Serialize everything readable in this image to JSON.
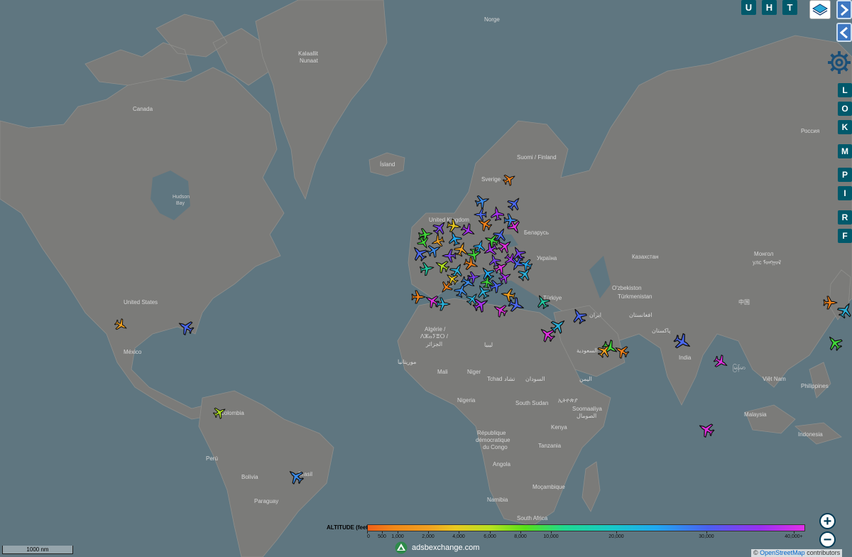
{
  "toolbar": {
    "btn_u": "U",
    "btn_h": "H",
    "btn_t": "T"
  },
  "side_buttons": [
    "L",
    "O",
    "K",
    "M",
    "P",
    "I",
    "R",
    "F"
  ],
  "map_labels": {
    "norge": "Norge",
    "kalaallit": "Kalaallit",
    "nunaat": "Nunaat",
    "canada": "Canada",
    "island": "Ísland",
    "hudson": "Hudson",
    "bay": "Bay",
    "united_states": "United States",
    "mexico": "México",
    "sverige": "Sverige",
    "suomi": "Suomi / Finland",
    "united_kingdom": "United Kingdom",
    "belarus": "Беларусь",
    "ukraina": "Україна",
    "rossiya": "Россия",
    "kazakhstan": "Казахстан",
    "mongol": "Монгол",
    "mongol2": "улс ᠮᠣᠩᠭᠣᠯ",
    "ozbekiston": "O'zbekiston",
    "turkmenistan": "Türkmenistan",
    "turkiye": "Türkiye",
    "iran": "ایران",
    "afghanistan": "افغانستان",
    "pakistan": "پاکستان",
    "china": "中国",
    "algerie": "Algérie /",
    "algerie2": "ⴷⵣⴰⵢⴻⵔ /",
    "algerie3": "الجزائر",
    "libya": "ليبيا",
    "mauritania": "موريتانيا",
    "mali": "Mali",
    "niger": "Niger",
    "tchad": "Tchad",
    "tchad2": "تشاد",
    "sudan": "السودان",
    "saudi": "السعودية",
    "yemen": "اليمن",
    "ethiopia": "ኢትዮጵያ",
    "nigeria": "Nigeria",
    "south_sudan": "South Sudan",
    "soomaaliya": "Soomaaliya",
    "soomaaliya2": "الصومال",
    "kenya": "Kenya",
    "rdc1": "République",
    "rdc2": "démocratique",
    "rdc3": "du Congo",
    "tanzania": "Tanzania",
    "angola": "Angola",
    "mocambique": "Moçambique",
    "namibia": "Namibia",
    "south_africa": "South Africa",
    "india": "India",
    "myanmar": "မြန်မာ",
    "viet_nam": "Việt Nam",
    "philippines": "Philippines",
    "malaysia": "Malaysia",
    "indonesia": "Indonesia",
    "colombia": "Colombia",
    "peru": "Perú",
    "bolivia": "Bolivia",
    "paraguay": "Paraguay",
    "brasil": "Brasil"
  },
  "legend": {
    "title": "ALTITUDE (feet)",
    "ticks": [
      "0",
      "500",
      "1,000",
      "2,000",
      "4,000",
      "6,000",
      "8,000",
      "10,000",
      "20,000",
      "30,000",
      "40,000+"
    ]
  },
  "brand": "adsbexchange.com",
  "scale_label": "1000 nm",
  "attribution_prefix": "© ",
  "attribution_link": "OpenStreetMap",
  "attribution_suffix": " contributors",
  "colors": {
    "ocean": "#5f7680",
    "land": "#7b7b79",
    "button": "#00596b"
  },
  "aircraft_count_note": "",
  "zoom": {
    "in": "+",
    "out": "−"
  }
}
